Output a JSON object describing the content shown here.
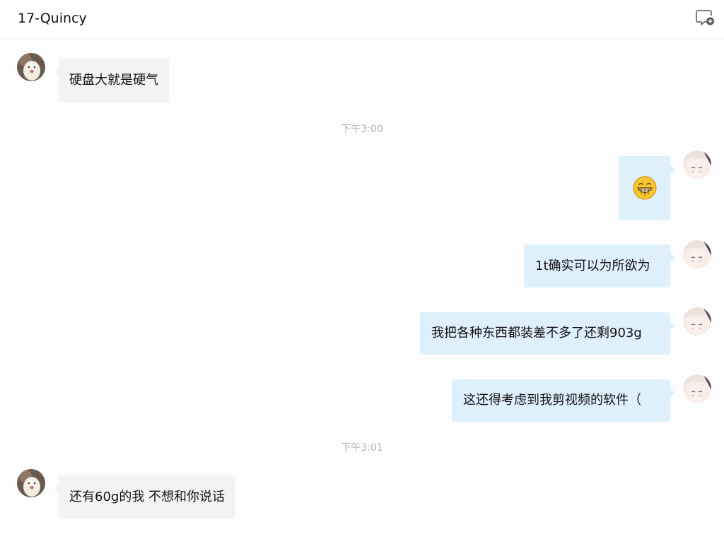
{
  "header": {
    "title": "17-Quincy",
    "icon": "new-comment-icon"
  },
  "messages": [
    {
      "side": "in",
      "text": "硬盘大就是硬气"
    },
    {
      "time": "下午3:00"
    },
    {
      "side": "out",
      "emoji": "grinning-face-icon"
    },
    {
      "side": "out",
      "text": "1t确实可以为所欲为"
    },
    {
      "side": "out",
      "text": "我把各种东西都装差不多了还剩903g"
    },
    {
      "side": "out",
      "text": "这还得考虑到我剪视频的软件（"
    },
    {
      "time": "下午3:01"
    },
    {
      "side": "in",
      "text": "还有60g的我 不想和你说话"
    }
  ],
  "colors": {
    "incoming_bubble": "#f3f3f3",
    "outgoing_bubble": "#dff0fd",
    "timestamp": "#b4b4b4"
  }
}
